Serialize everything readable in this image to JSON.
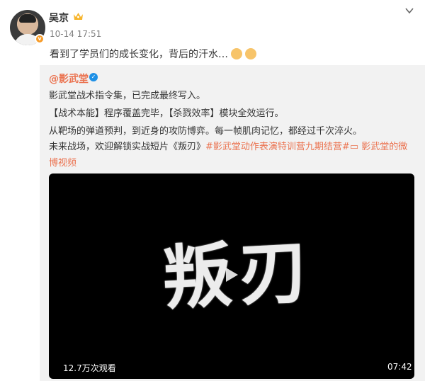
{
  "post": {
    "username": "吴京",
    "timestamp": "10-14 17:51",
    "text": "看到了学员们的成长变化，背后的汗水…",
    "emojis": [
      "thumbs-up-emoji",
      "fist-emoji"
    ]
  },
  "repost": {
    "handle": "@影武堂",
    "line1": "影武堂战术指令集，已完成最终写入。",
    "line2": "【战术本能】程序覆盖完毕，【杀戮效率】模块全效运行。",
    "line3": "从靶场的弹道预判，到近身的攻防博弈。每一帧肌肉记忆，都经过千次淬火。",
    "line4_text": "未来战场，欢迎解锁实战短片《叛刃》",
    "line4_hashtag": "#影武堂动作表演特训营九期结营#",
    "line4_link": " 影武堂的微",
    "line5_link": "博视频"
  },
  "video": {
    "title": "叛刃",
    "view_count": "12.7万次观看",
    "duration": "07:42"
  },
  "colors": {
    "link": "#eb7350",
    "verified_orange": "#f79b27",
    "verified_blue": "#1e90e6",
    "repost_bg": "#f2f2f2"
  }
}
